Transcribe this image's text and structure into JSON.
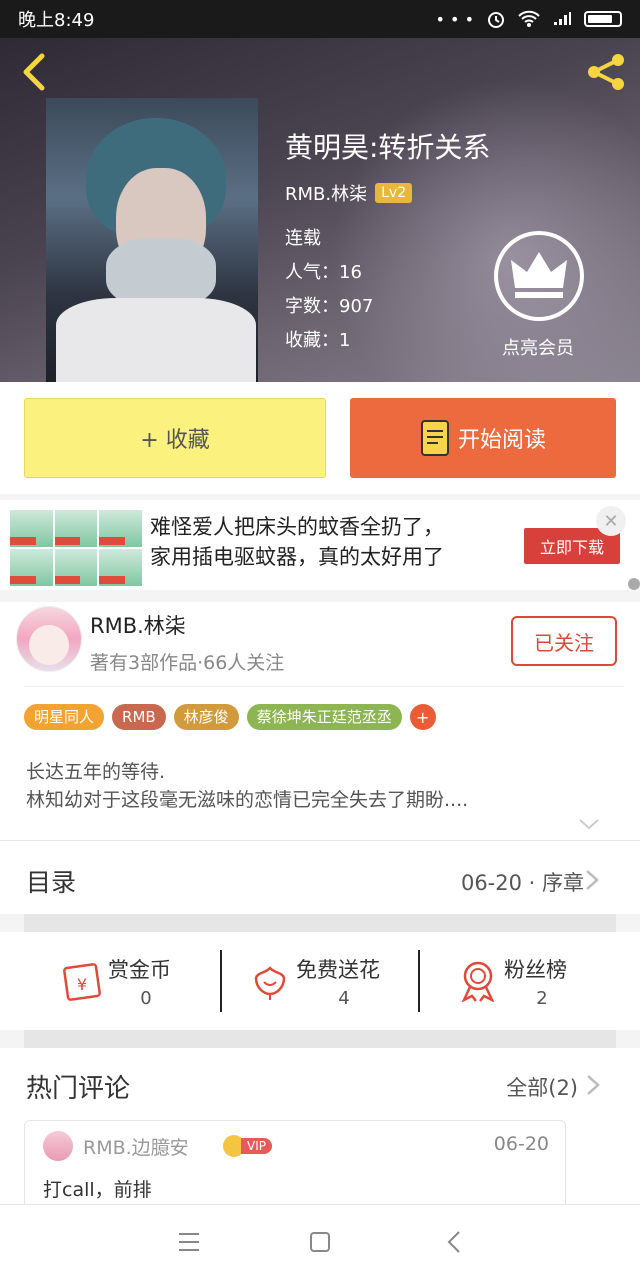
{
  "status_bar": {
    "time": "晚上8:49",
    "icons": "• • •"
  },
  "header": {
    "back_icon": "chevron-left-icon",
    "share_icon": "share-icon",
    "title": "黄明昊:转折关系",
    "author": "RMB.林柒",
    "level": "Lv2",
    "status": "连载",
    "popularity": "人气：16",
    "words": "字数：907",
    "favorites": "收藏：1",
    "vip_label": "点亮会员"
  },
  "actions": {
    "favorite_label": "+ 收藏",
    "read_label": "开始阅读"
  },
  "ad": {
    "line1": "难怪爱人把床头的蚊香全扔了，",
    "line2": "家用插电驱蚊器，真的太好用了",
    "cta": "立即下载",
    "close": "✕"
  },
  "author_card": {
    "name": "RMB.林柒",
    "subtitle": "著有3部作品·66人关注",
    "follow_label": "已关注",
    "tags": [
      {
        "label": "明星同人",
        "color": "#f3a330"
      },
      {
        "label": "RMB",
        "color": "#c8684e"
      },
      {
        "label": "林彦俊",
        "color": "#d19a3d"
      },
      {
        "label": "蔡徐坤朱正廷范丞丞",
        "color": "#8db653"
      }
    ],
    "tag_add": "+",
    "desc_line1": "长达五年的等待.",
    "desc_line2": "林知幼对于这段毫无滋味的恋情已完全失去了期盼...."
  },
  "toc": {
    "title": "目录",
    "latest": "06-20 · 序章"
  },
  "stats": [
    {
      "label": "赏金币",
      "value": "0",
      "icon": "reward-coin-icon"
    },
    {
      "label": "免费送花",
      "value": "4",
      "icon": "flower-icon"
    },
    {
      "label": "粉丝榜",
      "value": "2",
      "icon": "medal-icon"
    }
  ],
  "comments": {
    "title": "热门评论",
    "all_label": "全部(2)",
    "item": {
      "user": "RMB.边臆安",
      "vip": "VIP",
      "date": "06-20",
      "text": "打call，前排"
    }
  },
  "nav": {
    "menu_icon": "menu-icon",
    "home_icon": "home-icon",
    "back_icon": "back-icon"
  },
  "colors": {
    "accent": "#ec6a3d",
    "favorite": "#fbf17e",
    "follow": "#d94a3d",
    "lv": "#e9b83a"
  }
}
